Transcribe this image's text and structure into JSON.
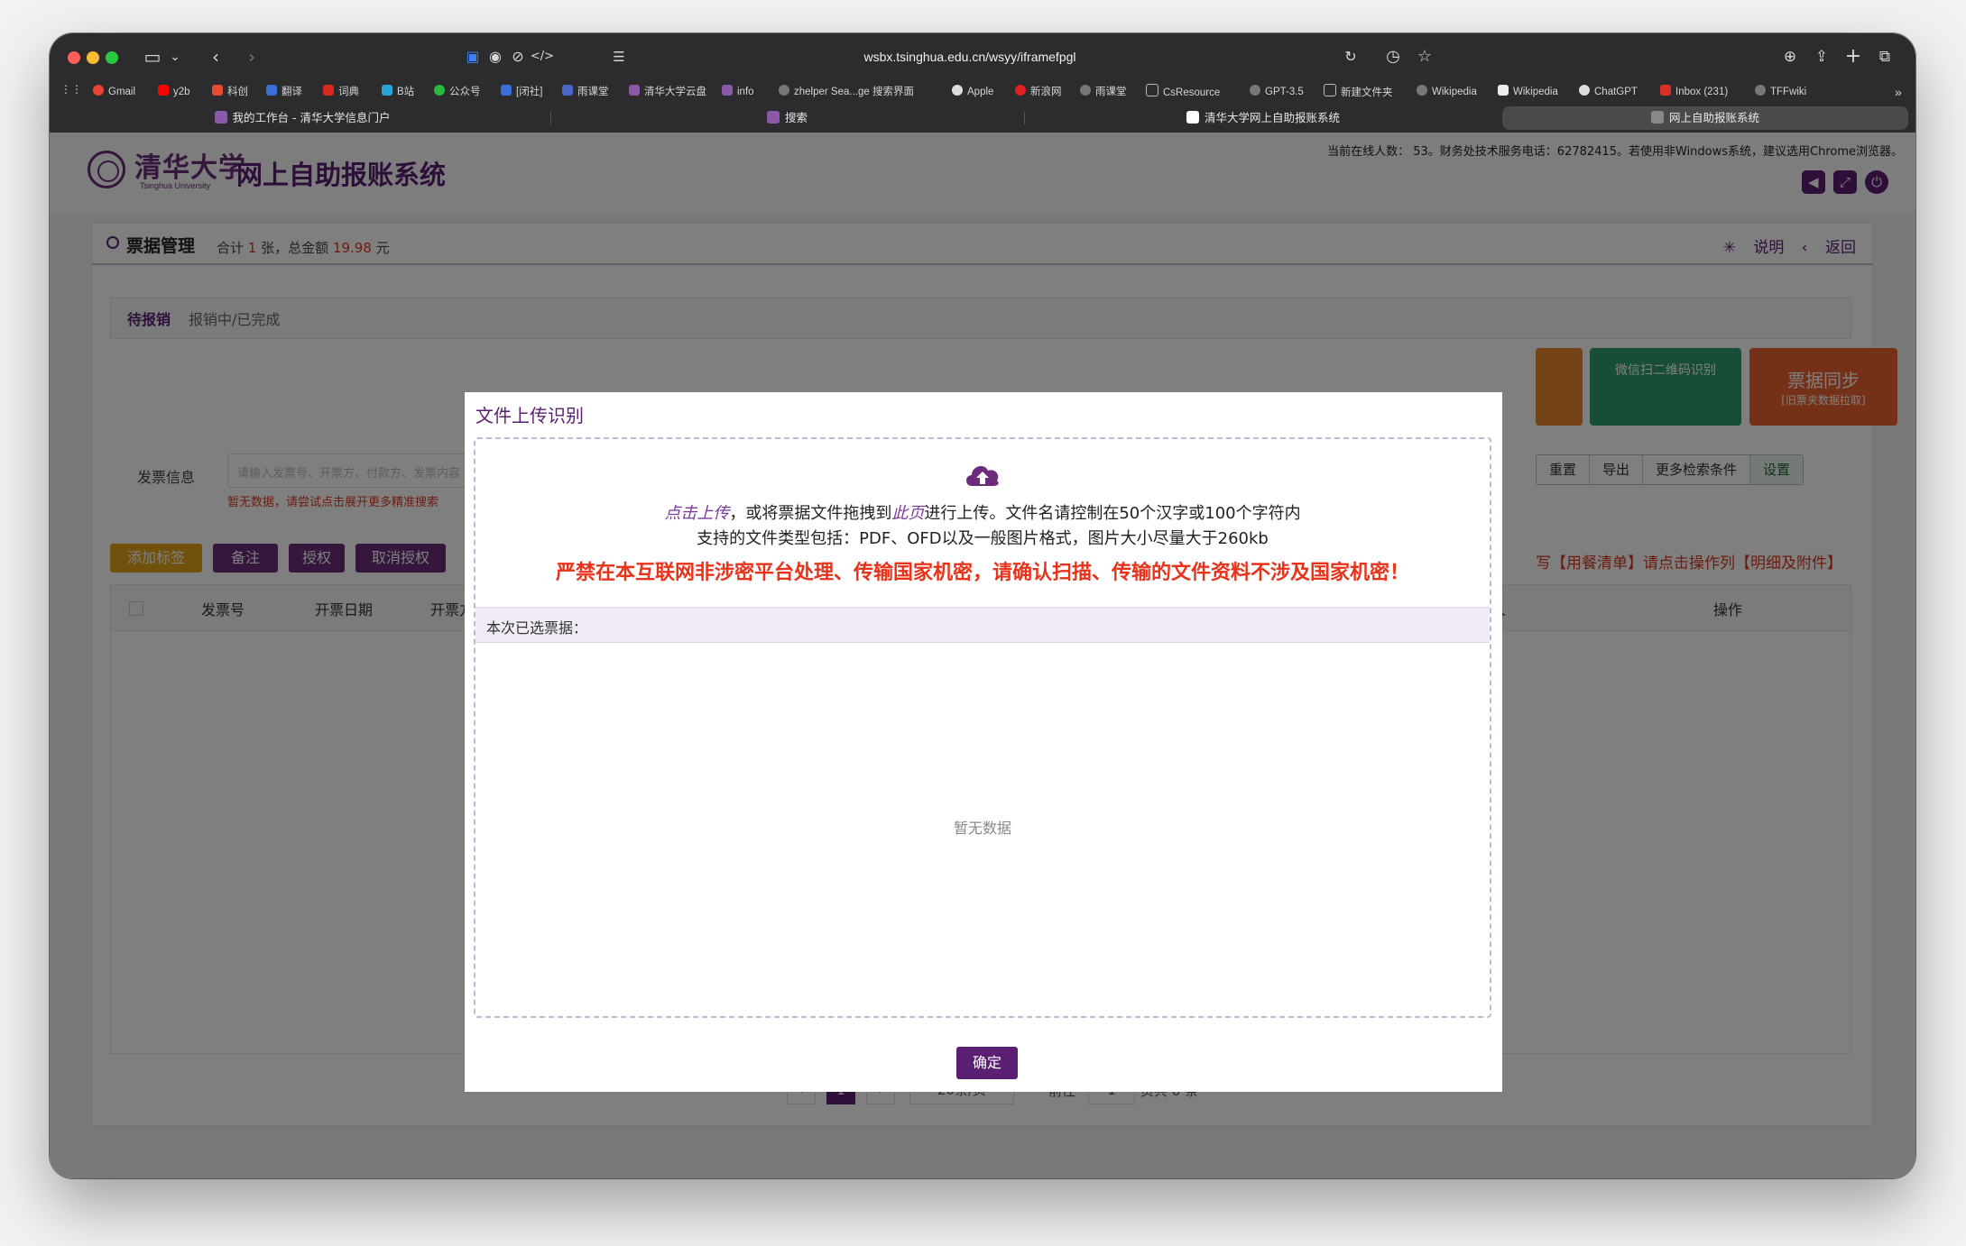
{
  "browser": {
    "url": "wsbx.tsinghua.edu.cn/wsyy/iframefpgl",
    "bookmarks": [
      "Gmail",
      "y2b",
      "科创",
      "翻译",
      "词典",
      "B站",
      "公众号",
      "[闭社]",
      "雨课堂",
      "清华大学云盘",
      "info",
      "zhelper Sea...ge 搜索界面",
      "Apple",
      "新浪网",
      "雨课堂",
      "CsResource",
      "GPT-3.5",
      "新建文件夹",
      "Wikipedia",
      "Wikipedia",
      "ChatGPT",
      "Inbox (231)",
      "TFFwiki"
    ],
    "tabs": [
      {
        "label": "我的工作台 - 清华大学信息门户"
      },
      {
        "label": "搜索"
      },
      {
        "label": "清华大学网上自助报账系统"
      },
      {
        "label": "网上自助报账系统"
      }
    ]
  },
  "header": {
    "logo_cn": "清华大学",
    "logo_en": "Tsinghua University",
    "site_title": "网上自助报账系统",
    "online_info": "当前在线人数： 53。财务处技术服务电话：62782415。若使用非Windows系统，建议选用Chrome浏览器。"
  },
  "card": {
    "title": "票据管理",
    "sum_prefix": "合计",
    "count": "1",
    "sum_mid": "张，总金额",
    "amount": "19.98",
    "sum_suffix": "元",
    "link_help": "说明",
    "link_back": "返回",
    "tab_pending": "待报销",
    "tab_done": "报销中/已完成",
    "tile_wechat": "微信扫二维码识别",
    "tile_sync": "票据同步",
    "tile_sync_sub": "[旧票夹数据拉取]",
    "search_label": "发票信息",
    "search_placeholder": "请输入发票号、开票方、付款方、发票内容",
    "search_hint": "暂无数据，请尝试点击展开更多精准搜索",
    "btn_reset": "重置",
    "btn_export": "导出",
    "btn_more": "更多检索条件",
    "btn_settings": "设置",
    "btn_add_tag": "添加标签",
    "btn_note": "备注",
    "btn_auth": "授权",
    "btn_cancel_auth": "取消授权",
    "hint_red": "写【用餐清单】请点击操作列【明细及附件】",
    "col_invoice_no": "发票号",
    "col_date": "开票日期",
    "col_issuer": "开票方",
    "col_person": "人",
    "col_ops": "操作",
    "pager_page": "1",
    "pager_size": "20条/页",
    "pager_goto": "前往",
    "pager_goto_value": "1",
    "pager_total": "页共 0 条"
  },
  "modal": {
    "title": "文件上传识别",
    "click_upload": "点击上传",
    "line1_mid": "，或将票据文件拖拽到",
    "this_page": "此页",
    "line1_end": "进行上传。文件名请控制在50个汉字或100个字符内",
    "line2": "支持的文件类型包括：PDF、OFD以及一般图片格式，图片大小尽量大于260kb",
    "warning": "严禁在本互联网非涉密平台处理、传输国家机密，请确认扫描、传输的文件资料不涉及国家机密！",
    "selected_label": "本次已选票据：",
    "empty_text": "暂无数据",
    "confirm": "确定"
  },
  "colors": {
    "brand_purple": "#5a1f72",
    "warning_red": "#e8321a",
    "tag_gold": "#e0a51a"
  }
}
